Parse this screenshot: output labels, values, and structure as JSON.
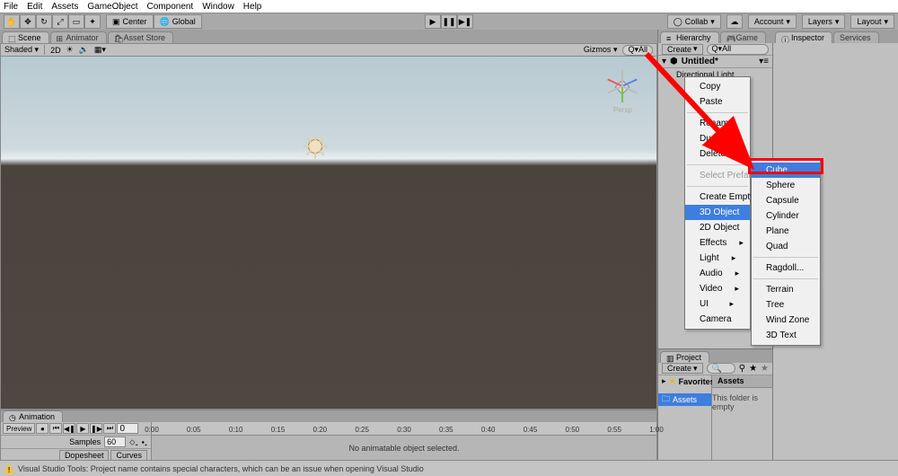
{
  "menu": {
    "file": "File",
    "edit": "Edit",
    "assets": "Assets",
    "gameObject": "GameObject",
    "component": "Component",
    "window": "Window",
    "help": "Help"
  },
  "toolbar": {
    "pivot": "Center",
    "space": "Global",
    "collab": "Collab",
    "account": "Account",
    "layers": "Layers",
    "layout": "Layout"
  },
  "tabs": {
    "scene": "Scene",
    "animator": "Animator",
    "assetStore": "Asset Store",
    "game": "Game",
    "hierarchy": "Hierarchy",
    "inspector": "Inspector",
    "services": "Services",
    "project": "Project",
    "animation": "Animation"
  },
  "sceneBar": {
    "shading": "Shaded",
    "mode2d": "2D",
    "gizmos": "Gizmos",
    "qall": "Q▾All"
  },
  "gizmo": {
    "persp": "Persp"
  },
  "hierarchy": {
    "create": "Create",
    "qall": "Q▾All",
    "sceneTitle": "Untitled*",
    "items": [
      "Directional Light"
    ]
  },
  "ctxMain": {
    "copy": "Copy",
    "paste": "Paste",
    "rename": "Rename",
    "duplicate": "Duplicate",
    "delete": "Delete",
    "selectPrefab": "Select Prefab",
    "createEmpty": "Create Empty",
    "obj3d": "3D Object",
    "obj2d": "2D Object",
    "effects": "Effects",
    "light": "Light",
    "audio": "Audio",
    "video": "Video",
    "ui": "UI",
    "camera": "Camera"
  },
  "ctxSub": {
    "cube": "Cube",
    "sphere": "Sphere",
    "capsule": "Capsule",
    "cylinder": "Cylinder",
    "plane": "Plane",
    "quad": "Quad",
    "ragdoll": "Ragdoll...",
    "terrain": "Terrain",
    "tree": "Tree",
    "windZone": "Wind Zone",
    "text3d": "3D Text"
  },
  "project": {
    "create": "Create",
    "favorites": "Favorites",
    "assets": "Assets",
    "crumb": "Assets",
    "empty": "This folder is empty"
  },
  "animation": {
    "preview": "Preview",
    "samples": "Samples",
    "samplesVal": "60",
    "frameVal": "0",
    "dopesheet": "Dopesheet",
    "curves": "Curves",
    "ticks": [
      "0:00",
      "0:05",
      "0:10",
      "0:15",
      "0:20",
      "0:25",
      "0:30",
      "0:35",
      "0:40",
      "0:45",
      "0:50",
      "0:55",
      "1:00"
    ],
    "noAnim": "No animatable object selected."
  },
  "status": "Visual Studio Tools: Project name contains special characters, which can be an issue when opening Visual Studio"
}
